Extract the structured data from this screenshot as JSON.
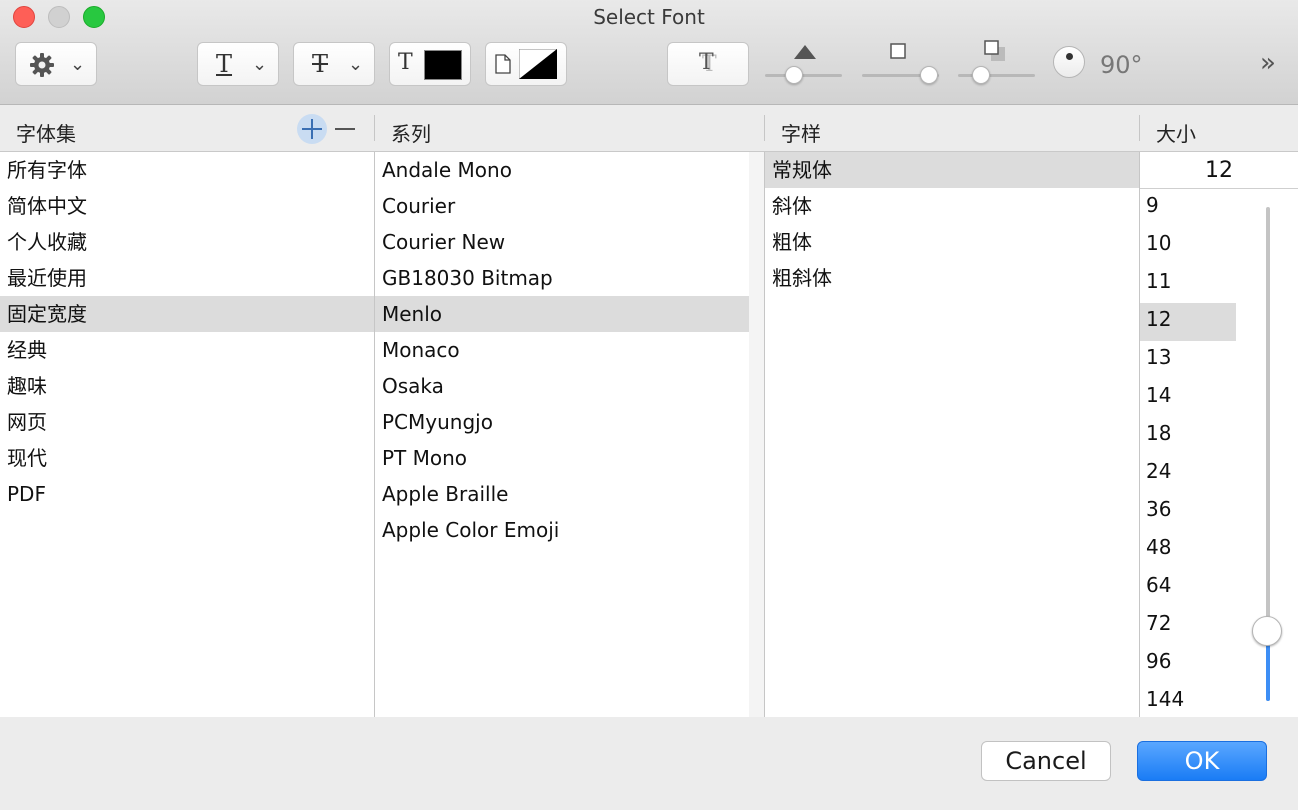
{
  "window": {
    "title": "Select Font"
  },
  "toolbar": {
    "rotation_label": "90°",
    "overflow_label": "»"
  },
  "headers": {
    "collections": "字体集",
    "family": "系列",
    "typeface": "字样",
    "size": "大小"
  },
  "collections": [
    "所有字体",
    "简体中文",
    "个人收藏",
    "最近使用",
    "固定宽度",
    "经典",
    "趣味",
    "网页",
    "现代",
    "PDF"
  ],
  "collections_selected": 4,
  "families": [
    "Andale Mono",
    "Courier",
    "Courier New",
    "GB18030 Bitmap",
    "Menlo",
    "Monaco",
    "Osaka",
    "PCMyungjo",
    "PT Mono",
    "Apple Braille",
    "Apple Color Emoji"
  ],
  "families_selected": 4,
  "typefaces": [
    "常规体",
    "斜体",
    "粗体",
    "粗斜体"
  ],
  "typefaces_selected": 0,
  "size": {
    "value": "12",
    "options": [
      "9",
      "10",
      "11",
      "12",
      "13",
      "14",
      "18",
      "24",
      "36",
      "48",
      "64",
      "72",
      "96",
      "144"
    ],
    "selected": 3
  },
  "buttons": {
    "cancel": "Cancel",
    "ok": "OK"
  },
  "colors": {
    "accent": "#1a7cf5",
    "selection": "#dcdcdc"
  }
}
